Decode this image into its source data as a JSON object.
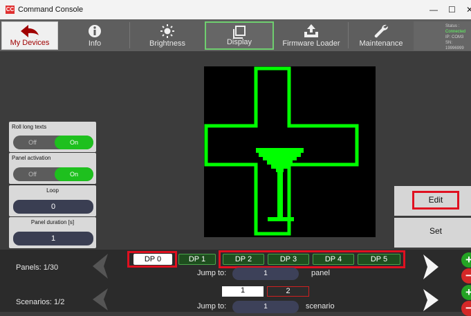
{
  "window": {
    "title": "Command Console",
    "icon": "cc-app-icon",
    "minimize": "—",
    "maximize": "☐",
    "close": "✕"
  },
  "toolbar": {
    "items": [
      {
        "label": "My Devices",
        "icon": "back-arrow-icon"
      },
      {
        "label": "Info",
        "icon": "info-icon"
      },
      {
        "label": "Brightness",
        "icon": "sun-icon"
      },
      {
        "label": "Display",
        "icon": "display-icon"
      },
      {
        "label": "Firmware Loader",
        "icon": "upload-icon"
      },
      {
        "label": "Maintenance",
        "icon": "wrench-icon"
      }
    ],
    "status": {
      "title": "Status :",
      "state": "Connected",
      "ip": "IP: COM3",
      "sn": "SN: 19996999"
    }
  },
  "controls": {
    "roll_long_texts": {
      "label": "Roll long texts",
      "off": "Off",
      "on": "On"
    },
    "panel_activation": {
      "label": "Panel activation",
      "off": "Off",
      "on": "On"
    },
    "loop": {
      "label": "Loop",
      "value": "0"
    },
    "panel_duration": {
      "label": "Panel duration [s]",
      "value": "1"
    }
  },
  "display": {
    "symbol": "pharmacy-cross-with-goblet",
    "color": "#00ff00"
  },
  "side_buttons": {
    "edit": "Edit",
    "set": "Set"
  },
  "panels": {
    "label": "Panels: 1/30",
    "items": [
      "DP 0",
      "DP 1",
      "DP 2",
      "DP 3",
      "DP 4",
      "DP 5"
    ],
    "selected": "DP 0",
    "jump_label": "Jump to:",
    "jump_value": "1",
    "jump_unit": "panel"
  },
  "scenarios": {
    "label": "Scenarios: 1/2",
    "items": [
      "1",
      "2"
    ],
    "selected": "1",
    "jump_label": "Jump to:",
    "jump_value": "1",
    "jump_unit": "scenario"
  },
  "colors": {
    "accent_green": "#1ec01e",
    "highlight_red": "#e01020",
    "active_tab_text": "#a00000"
  }
}
